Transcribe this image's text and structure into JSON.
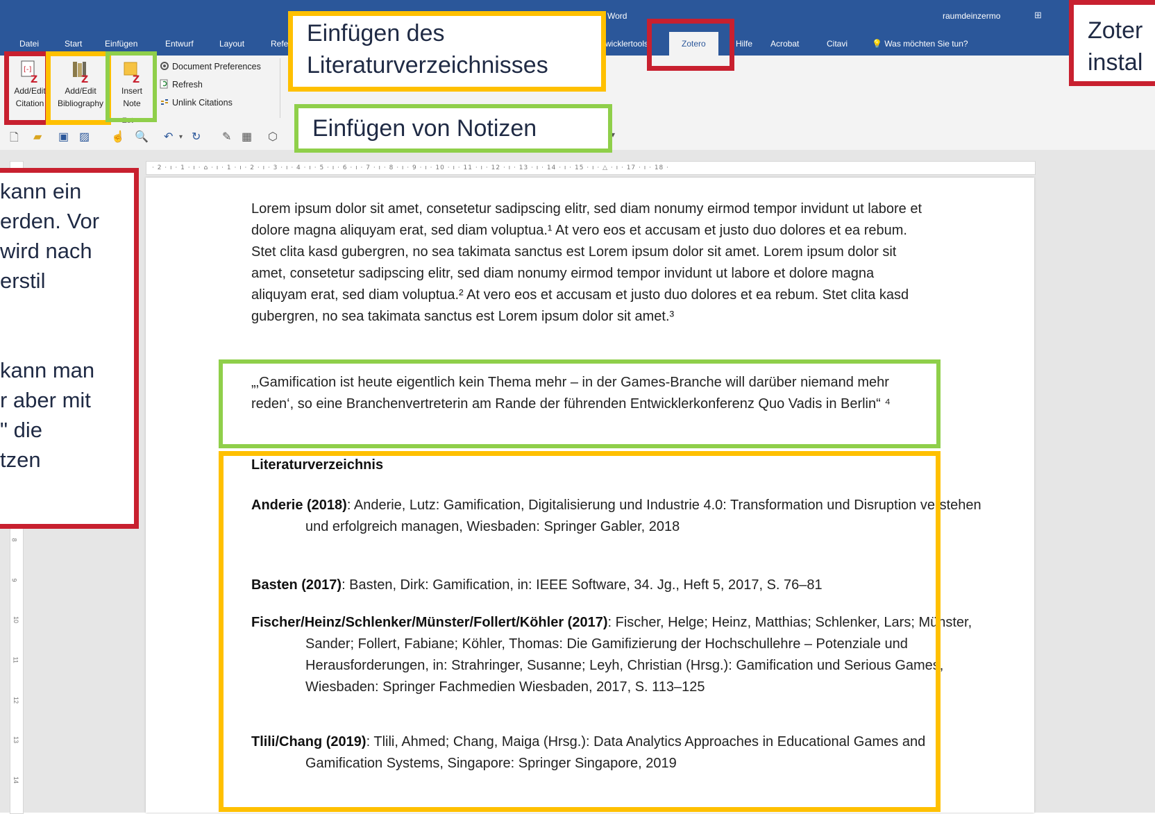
{
  "window": {
    "doc_title": "Word",
    "user_name": "raumdeinzermo"
  },
  "tabs": [
    {
      "label": "Datei",
      "active": false
    },
    {
      "label": "Start",
      "active": false
    },
    {
      "label": "Einfügen",
      "active": false
    },
    {
      "label": "Entwurf",
      "active": false
    },
    {
      "label": "Layout",
      "active": false
    },
    {
      "label": "Refe",
      "active": false
    },
    {
      "label": "wicklertools",
      "active": false
    },
    {
      "label": "Zotero",
      "active": true
    },
    {
      "label": "Hilfe",
      "active": false
    },
    {
      "label": "Acrobat",
      "active": false
    },
    {
      "label": "Citavi",
      "active": false
    }
  ],
  "tell_me": "Was möchten Sie tun?",
  "ribbon": {
    "add_edit_citation": [
      "Add/Edit",
      "Citation"
    ],
    "add_edit_bibliography": [
      "Add/Edit",
      "Bibliography"
    ],
    "insert_note": [
      "Insert",
      "Note"
    ],
    "document_preferences": "Document Preferences",
    "refresh": "Refresh",
    "unlink_citations": "Unlink Citations",
    "group_label": "Zot"
  },
  "annotations": {
    "bibliography": [
      "Einfügen des",
      "Literaturverzeichnisses"
    ],
    "notes": "Einfügen von Notizen",
    "install": [
      "Zoter",
      "instal"
    ],
    "left_text": [
      "kann ein",
      "erden. Vor",
      "wird nach",
      "erstil",
      "",
      "",
      "kann man",
      "r aber mit",
      "\" die",
      "tzen"
    ]
  },
  "ruler": "· 2 · ı · 1 · ı · ⌂ · ı · 1 · ı · 2 · ı · 3 · ı · 4 · ı · 5 · ı · 6 · ı · 7 · ı · 8 · ı · 9 · ı · 10 · ı · 11 · ı · 12 · ı · 13 · ı · 14 · ı · 15 · ı · △ · ı · 17 · ı · 18 ·",
  "vruler_numbers": [
    "8",
    "9",
    "10",
    "11",
    "12",
    "13",
    "14"
  ],
  "document": {
    "paragraph": "Lorem ipsum dolor sit amet, consetetur sadipscing elitr, sed diam nonumy eirmod tempor invidunt ut labore et dolore magna aliquyam erat, sed diam voluptua.¹ At vero eos et accusam et justo duo dolores et ea rebum. Stet clita kasd gubergren, no sea takimata sanctus est Lorem ipsum dolor sit amet. Lorem ipsum dolor sit amet, consetetur sadipscing elitr, sed diam nonumy eirmod tempor invidunt ut labore et dolore magna aliquyam erat, sed diam voluptua.² At vero eos et accusam et justo duo dolores et ea rebum. Stet clita kasd gubergren, no sea takimata sanctus est Lorem ipsum dolor sit amet.³",
    "quote": "„‚Gamification ist heute eigentlich kein Thema mehr – in der Games-Branche will darüber niemand mehr reden‘, so eine Branchenvertreterin am Rande der führenden Entwicklerkonferenz Quo Vadis in Berlin“ ⁴",
    "bib_heading": "Literaturverzeichnis",
    "references": [
      {
        "key": "Anderie (2018)",
        "text": ": Anderie, Lutz: Gamification, Digitalisierung und Industrie 4.0: Transformation und Disruption verstehen und erfolgreich managen, Wiesbaden: Springer Gabler, 2018"
      },
      {
        "key": "Basten (2017)",
        "text": ": Basten, Dirk: Gamification, in: IEEE Software, 34. Jg., Heft 5, 2017, S. 76–81"
      },
      {
        "key": "Fischer/Heinz/Schlenker/Münster/Follert/Köhler (2017)",
        "text": ": Fischer, Helge; Heinz, Matthias; Schlenker, Lars; Münster, Sander; Follert, Fabiane; Köhler, Thomas: Die Gamifizierung der Hochschullehre – Potenziale und Herausforderungen, in: Strahringer, Susanne; Leyh, Christian (Hrsg.): Gamification und Serious Games, Wiesbaden: Springer Fachmedien Wiesbaden, 2017, S. 113–125"
      },
      {
        "key": "Tlili/Chang (2019)",
        "text": ": Tlili, Ahmed; Chang, Maiga (Hrsg.): Data Analytics Approaches in Educational Games and Gamification Systems, Singapore: Springer Singapore, 2019"
      }
    ]
  },
  "colors": {
    "word_blue": "#2b579a",
    "red": "#c8202f",
    "yellow": "#ffc000",
    "green": "#8fcf4a"
  }
}
